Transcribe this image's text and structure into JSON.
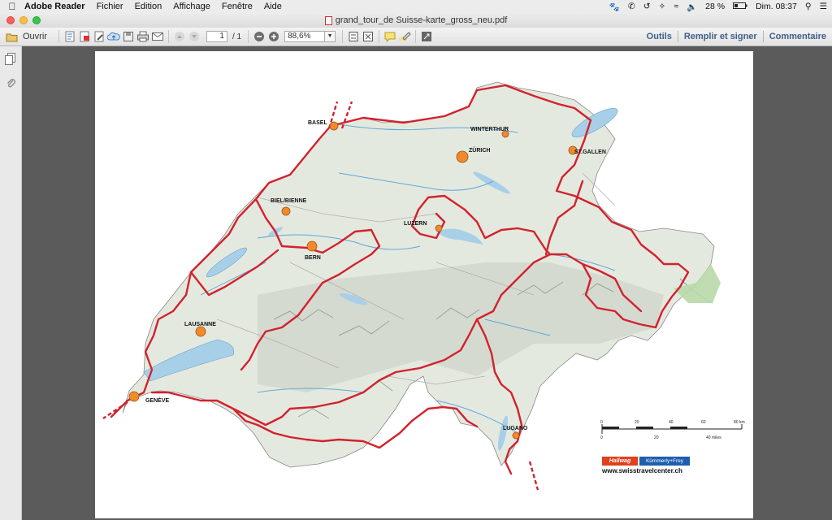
{
  "menubar": {
    "app_name": "Adobe Reader",
    "menus": [
      "Fichier",
      "Edition",
      "Affichage",
      "Fenêtre",
      "Aide"
    ],
    "battery": "28 %",
    "clock": "Dim. 08:37"
  },
  "window": {
    "title": "grand_tour_de Suisse-karte_gross_neu.pdf"
  },
  "toolbar": {
    "open_label": "Ouvrir",
    "page_current": "1",
    "page_total": "/ 1",
    "zoom": "88,6%",
    "tools_label": "Outils",
    "fill_sign_label": "Remplir et signer",
    "comment_label": "Commentaire"
  },
  "map": {
    "cities": [
      "BASEL",
      "WINTERTHUR",
      "ZÜRICH",
      "ST.GALLEN",
      "BIEL/BIENNE",
      "LUZERN",
      "BERN",
      "LAUSANNE",
      "GENÈVE",
      "LUGANO"
    ],
    "scale_km": [
      "0",
      "20",
      "40",
      "60",
      "80 km"
    ],
    "scale_miles": [
      "0",
      "20",
      "40 miles"
    ],
    "publisher_1": "Hallwag",
    "publisher_2": "Kümmerly+Frey",
    "website": "www.swisstravelcenter.ch"
  }
}
